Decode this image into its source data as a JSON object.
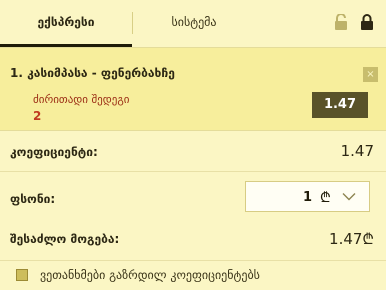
{
  "tabs": [
    {
      "label": "ექსპრესი",
      "active": true
    },
    {
      "label": "სისტემა",
      "active": false
    }
  ],
  "icons": {
    "lock_open": "lock-open-icon",
    "lock_closed": "lock-closed-icon"
  },
  "bet": {
    "index": "1.",
    "event": "კასიმპასა - ფენერბახჩე",
    "market": "ძირითადი შედეგი",
    "outcome": "2",
    "odds": "1.47",
    "remove_symbol": "×"
  },
  "summary": {
    "coef_label": "კოეფიციენტი:",
    "coef_value": "1.47",
    "stake_label": "ფსონი:",
    "stake_value": "1",
    "currency": "₾",
    "possible_win_label": "შესაძლო მოგება:",
    "possible_win_value": "1.47₾"
  },
  "agree": {
    "label": "ვეთანხმები გაზრდილ კოეფიციენტებს",
    "checked": true
  },
  "colors": {
    "background": "#fbf6c4",
    "bet_background": "#f7ee9c",
    "odds_box": "#595229",
    "outcome_red": "#c03a20"
  }
}
